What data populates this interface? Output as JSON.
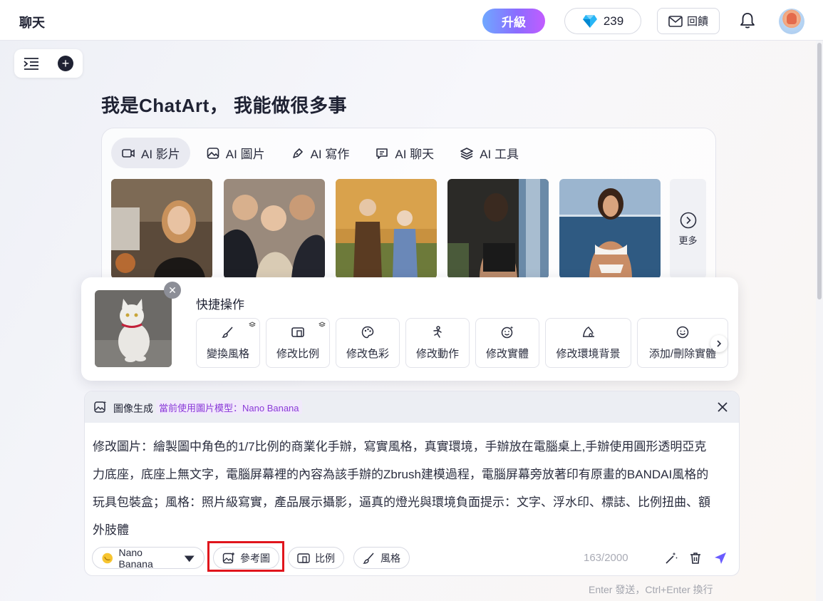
{
  "topbar": {
    "title": "聊天",
    "upgrade_label": "升級",
    "gem_count": "239",
    "feedback_label": "回饋",
    "gem_icon": "diamond-icon",
    "bell_icon": "bell-icon",
    "accent": "#8b6cff"
  },
  "heading": "我是ChatArt， 我能做很多事",
  "tabs": [
    {
      "label": "AI 影片",
      "icon": "video-icon",
      "active": true
    },
    {
      "label": "AI 圖片",
      "icon": "image-icon",
      "active": false
    },
    {
      "label": "AI 寫作",
      "icon": "pen-icon",
      "active": false
    },
    {
      "label": "AI 聊天",
      "icon": "chat-icon",
      "active": false
    },
    {
      "label": "AI 工具",
      "icon": "layers-icon",
      "active": false
    }
  ],
  "gallery": {
    "more_label": "更多"
  },
  "quick_actions": {
    "title": "快捷操作",
    "items": [
      {
        "label": "變換風格",
        "icon": "brush-icon",
        "badge": true
      },
      {
        "label": "修改比例",
        "icon": "aspect-ratio-icon",
        "badge": true
      },
      {
        "label": "修改色彩",
        "icon": "palette-icon",
        "badge": false
      },
      {
        "label": "修改動作",
        "icon": "pose-icon",
        "badge": false
      },
      {
        "label": "修改實體",
        "icon": "sparkle-face-icon",
        "badge": false
      },
      {
        "label": "修改環境背景",
        "icon": "scene-icon",
        "badge": false
      },
      {
        "label": "添加/刪除實體",
        "icon": "smile-icon",
        "badge": false
      }
    ]
  },
  "prompt": {
    "mode_label": "圖像生成",
    "model_note": "當前使用圖片模型：Nano Banana",
    "lines": [
      "修改圖片：繪製圖中角色的1/7比例的商業化手辦，寫實風格，真實環境，手辦放在電腦桌上,手辦使用圓形透明亞克",
      "力底座，底座上無文字，電腦屏幕裡的內容為該手辦的Zbrush建模過程，電腦屏幕旁放著印有原畫的BANDAI風格的",
      "玩具包裝盒；風格：照片級寫實，產品展示攝影，逼真的燈光與環境負面提示：文字、浮水印、標誌、比例扭曲、額",
      "外肢體"
    ],
    "model_select": "Nano Banana",
    "reference_label": "參考圖",
    "ratio_label": "比例",
    "style_label": "風格",
    "counter": "163/2000",
    "hint": "Enter 發送，Ctrl+Enter 換行"
  }
}
